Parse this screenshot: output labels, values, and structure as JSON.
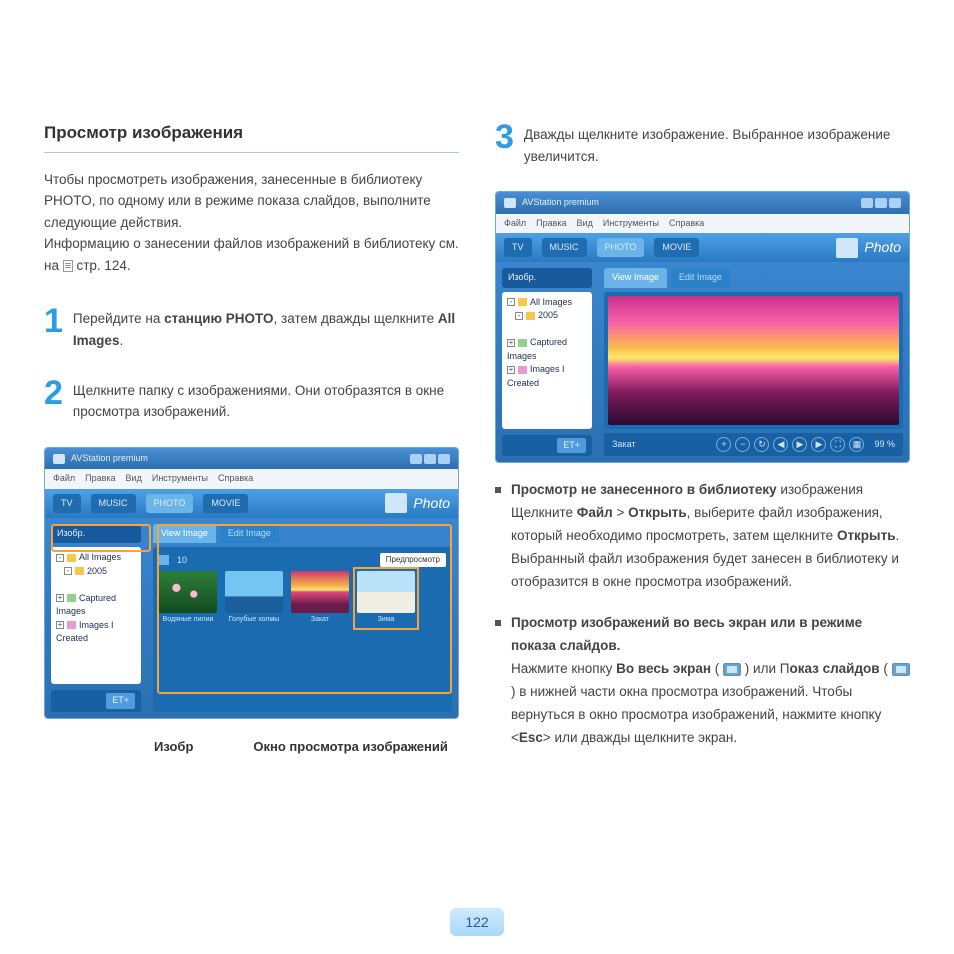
{
  "heading": "Просмотр изображения",
  "intro_1": "Чтобы просмотреть изображения, занесенные в библиотеку PHOTO, по одному или в режиме показа слайдов, выполните следующие действия.",
  "intro_2a": "Информацию о занесении файлов изображений в библиотеку см. на ",
  "intro_2b": " стр. 124.",
  "steps": {
    "s1": {
      "num": "1",
      "a": "Перейдите на ",
      "b": "станцию PHOTO",
      "c": ", затем дважды щелкните ",
      "d": "All Images",
      "e": "."
    },
    "s2": {
      "num": "2",
      "text": "Щелкните папку с изображениями. Они отобразятся в окне просмотра изображений."
    },
    "s3": {
      "num": "3",
      "text": "Дважды щелкните изображение. Выбранное изображение увеличится."
    }
  },
  "app": {
    "title": "AVStation premium",
    "menus": [
      "Файл",
      "Правка",
      "Вид",
      "Инструменты",
      "Справка"
    ],
    "tabs": [
      "TV",
      "MUSIC",
      "PHOTO",
      "MOVIE"
    ],
    "brand": "Photo",
    "side_hdr": "Изобр.",
    "tree": {
      "all": "All Images",
      "yr": "2005",
      "cap": "Captured Images",
      "cre": "Images I Created"
    },
    "ctabs": {
      "view": "View Image",
      "edit": "Edit Image"
    },
    "count": "10",
    "preview_btn": "Предпросмотр",
    "thumbs": [
      "Водяные лилии",
      "Голубые холмы",
      "Закат",
      "Зима"
    ],
    "status_lbl": "Закат",
    "pct": "99 %",
    "add_btn": "ET+"
  },
  "callouts": {
    "a": "Изобр",
    "b": "Окно просмотра изображений"
  },
  "bullets": {
    "b1": {
      "h": "Просмотр не занесенного в библиотеку",
      "t1": " изображения Щелкните ",
      "f": "Файл",
      "gt": " > ",
      "o1": "Открыть",
      "t2": ", выберите файл изображения, который необходимо просмотреть, затем щелкните ",
      "o2": "Открыть",
      "t3": ". Выбранный файл изображения будет занесен в библиотеку и отобразится в окне просмотра изображений."
    },
    "b2": {
      "h": "Просмотр изображений во весь экран или в режиме показа слайдов.",
      "t1": "Нажмите кнопку ",
      "fs": "Во весь экран",
      "p1": " ( ",
      "p2": " ) или П",
      "ss": "оказ слайдов",
      "p3": " ( ",
      "p4": " ) в нижней части окна просмотра изображений. Чтобы вернуться в окно просмотра изображений, нажмите кнопку <",
      "esc": "Esc",
      "p5": "> или дважды щелкните экран."
    }
  },
  "page_number": "122"
}
